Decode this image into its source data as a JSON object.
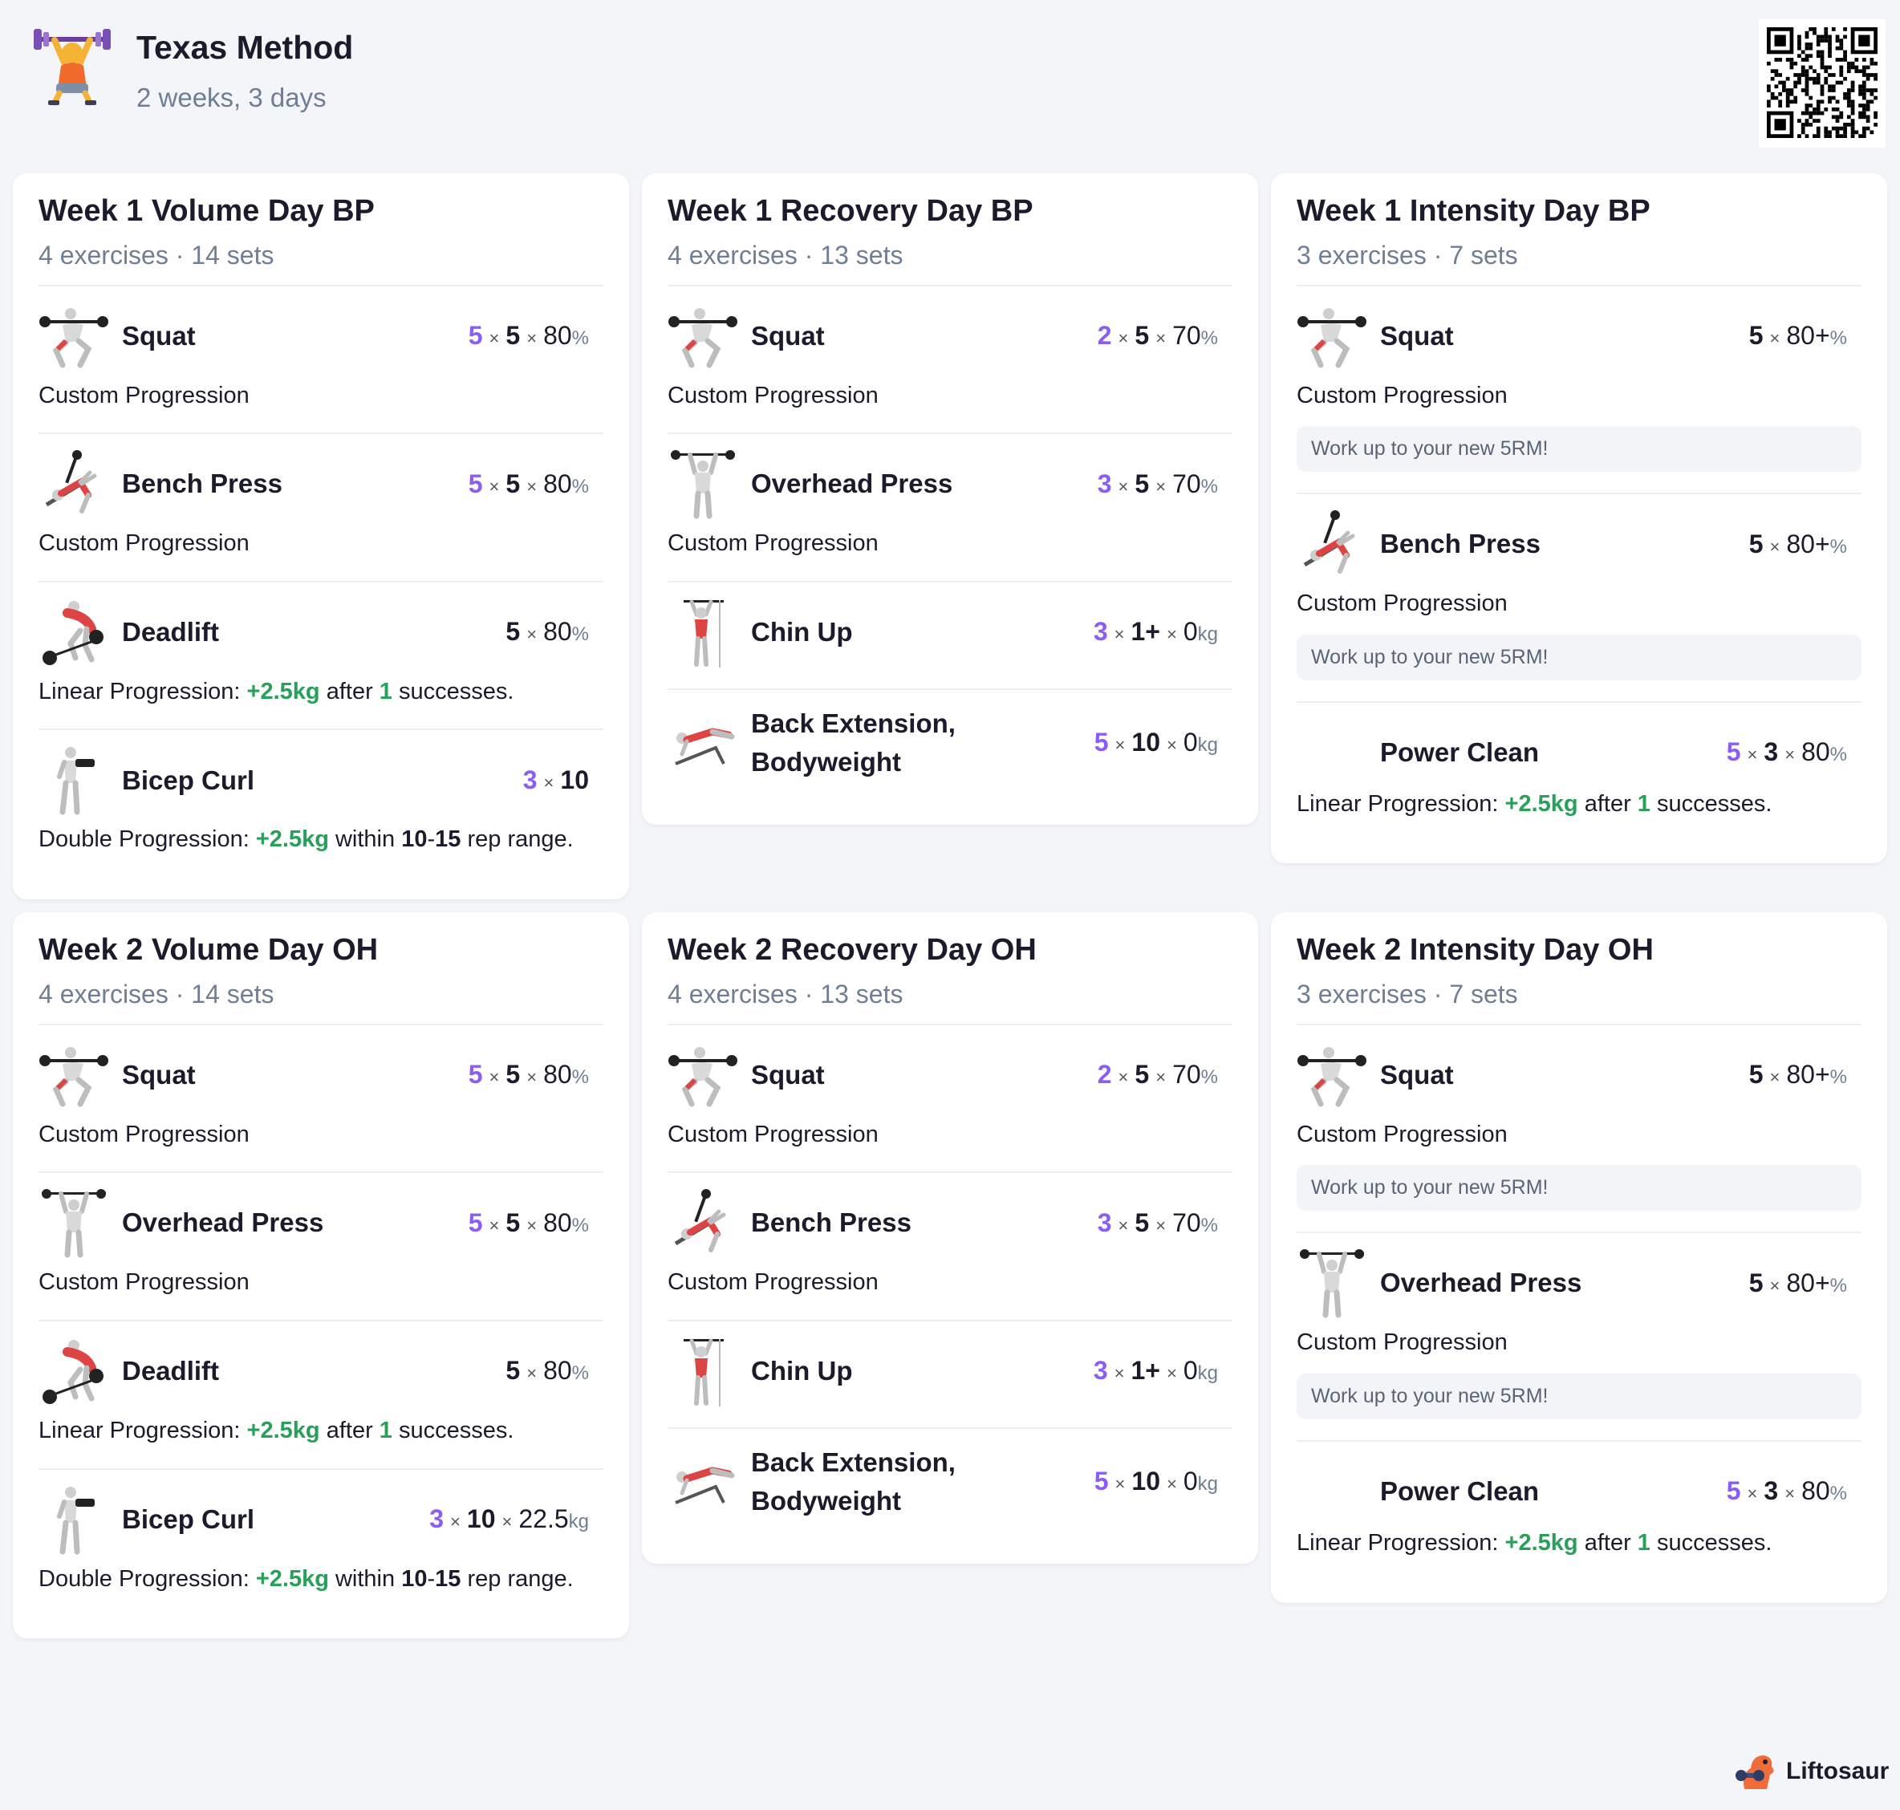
{
  "program": {
    "title": "Texas Method",
    "subtitle": "2 weeks, 3 days"
  },
  "brand": {
    "name": "Liftosaur"
  },
  "icons": {
    "logo": "weightlifter-icon",
    "qr": "qr-code-icon",
    "brand": "dino-icon"
  },
  "colors": {
    "accent": "#8b5cf6",
    "positive": "#28a05a",
    "muted": "#6f7e92"
  },
  "days": [
    {
      "title": "Week 1 Volume Day BP",
      "meta": "4 exercises · 14 sets",
      "exercises": [
        {
          "name": "Squat",
          "icon": "squat",
          "sets": "5",
          "reps": "5",
          "weight": "80",
          "unit": "%",
          "prog_type": "custom",
          "prog_text": "Custom Progression"
        },
        {
          "name": "Bench Press",
          "icon": "bench",
          "sets": "5",
          "reps": "5",
          "weight": "80",
          "unit": "%",
          "prog_type": "custom",
          "prog_text": "Custom Progression"
        },
        {
          "name": "Deadlift",
          "icon": "deadlift",
          "sets": "",
          "reps": "5",
          "weight": "80",
          "unit": "%",
          "prog_type": "linear",
          "prog_label": "Linear Progression:",
          "inc": "+2.5kg",
          "word": "after",
          "count": "1",
          "tail": "successes."
        },
        {
          "name": "Bicep Curl",
          "icon": "curl",
          "sets": "3",
          "reps": "10",
          "weight": "",
          "unit": "",
          "prog_type": "double",
          "prog_label": "Double Progression:",
          "inc": "+2.5kg",
          "word": "within",
          "lo": "10",
          "sep": "-",
          "hi": "15",
          "tail": "rep range."
        }
      ]
    },
    {
      "title": "Week 1 Recovery Day BP",
      "meta": "4 exercises · 13 sets",
      "exercises": [
        {
          "name": "Squat",
          "icon": "squat",
          "sets": "2",
          "reps": "5",
          "weight": "70",
          "unit": "%",
          "prog_type": "custom",
          "prog_text": "Custom Progression"
        },
        {
          "name": "Overhead Press",
          "icon": "ohp",
          "sets": "3",
          "reps": "5",
          "weight": "70",
          "unit": "%",
          "prog_type": "custom",
          "prog_text": "Custom Progression"
        },
        {
          "name": "Chin Up",
          "icon": "chin",
          "sets": "3",
          "reps": "1+",
          "weight": "0",
          "unit": "kg",
          "prog_type": "none"
        },
        {
          "name": "Back Extension, Bodyweight",
          "icon": "backext",
          "sets": "5",
          "reps": "10",
          "weight": "0",
          "unit": "kg",
          "prog_type": "none"
        }
      ]
    },
    {
      "title": "Week 1 Intensity Day BP",
      "meta": "3 exercises · 7 sets",
      "exercises": [
        {
          "name": "Squat",
          "icon": "squat",
          "sets": "",
          "reps": "5",
          "weight": "80+",
          "unit": "%",
          "prog_type": "custom",
          "prog_text": "Custom Progression",
          "note": "Work up to your new 5RM!"
        },
        {
          "name": "Bench Press",
          "icon": "bench",
          "sets": "",
          "reps": "5",
          "weight": "80+",
          "unit": "%",
          "prog_type": "custom",
          "prog_text": "Custom Progression",
          "note": "Work up to your new 5RM!"
        },
        {
          "name": "Power Clean",
          "icon": "",
          "sets": "5",
          "reps": "3",
          "weight": "80",
          "unit": "%",
          "prog_type": "linear",
          "prog_label": "Linear Progression:",
          "inc": "+2.5kg",
          "word": "after",
          "count": "1",
          "tail": "successes."
        }
      ]
    },
    {
      "title": "Week 2 Volume Day OH",
      "meta": "4 exercises · 14 sets",
      "exercises": [
        {
          "name": "Squat",
          "icon": "squat",
          "sets": "5",
          "reps": "5",
          "weight": "80",
          "unit": "%",
          "prog_type": "custom",
          "prog_text": "Custom Progression"
        },
        {
          "name": "Overhead Press",
          "icon": "ohp",
          "sets": "5",
          "reps": "5",
          "weight": "80",
          "unit": "%",
          "prog_type": "custom",
          "prog_text": "Custom Progression"
        },
        {
          "name": "Deadlift",
          "icon": "deadlift",
          "sets": "",
          "reps": "5",
          "weight": "80",
          "unit": "%",
          "prog_type": "linear",
          "prog_label": "Linear Progression:",
          "inc": "+2.5kg",
          "word": "after",
          "count": "1",
          "tail": "successes."
        },
        {
          "name": "Bicep Curl",
          "icon": "curl",
          "sets": "3",
          "reps": "10",
          "weight": "22.5",
          "unit": "kg",
          "prog_type": "double",
          "prog_label": "Double Progression:",
          "inc": "+2.5kg",
          "word": "within",
          "lo": "10",
          "sep": "-",
          "hi": "15",
          "tail": "rep range."
        }
      ]
    },
    {
      "title": "Week 2 Recovery Day OH",
      "meta": "4 exercises · 13 sets",
      "exercises": [
        {
          "name": "Squat",
          "icon": "squat",
          "sets": "2",
          "reps": "5",
          "weight": "70",
          "unit": "%",
          "prog_type": "custom",
          "prog_text": "Custom Progression"
        },
        {
          "name": "Bench Press",
          "icon": "bench",
          "sets": "3",
          "reps": "5",
          "weight": "70",
          "unit": "%",
          "prog_type": "custom",
          "prog_text": "Custom Progression"
        },
        {
          "name": "Chin Up",
          "icon": "chin",
          "sets": "3",
          "reps": "1+",
          "weight": "0",
          "unit": "kg",
          "prog_type": "none"
        },
        {
          "name": "Back Extension, Bodyweight",
          "icon": "backext",
          "sets": "5",
          "reps": "10",
          "weight": "0",
          "unit": "kg",
          "prog_type": "none"
        }
      ]
    },
    {
      "title": "Week 2 Intensity Day OH",
      "meta": "3 exercises · 7 sets",
      "exercises": [
        {
          "name": "Squat",
          "icon": "squat",
          "sets": "",
          "reps": "5",
          "weight": "80+",
          "unit": "%",
          "prog_type": "custom",
          "prog_text": "Custom Progression",
          "note": "Work up to your new 5RM!"
        },
        {
          "name": "Overhead Press",
          "icon": "ohp",
          "sets": "",
          "reps": "5",
          "weight": "80+",
          "unit": "%",
          "prog_type": "custom",
          "prog_text": "Custom Progression",
          "note": "Work up to your new 5RM!"
        },
        {
          "name": "Power Clean",
          "icon": "",
          "sets": "5",
          "reps": "3",
          "weight": "80",
          "unit": "%",
          "prog_type": "linear",
          "prog_label": "Linear Progression:",
          "inc": "+2.5kg",
          "word": "after",
          "count": "1",
          "tail": "successes."
        }
      ]
    }
  ]
}
